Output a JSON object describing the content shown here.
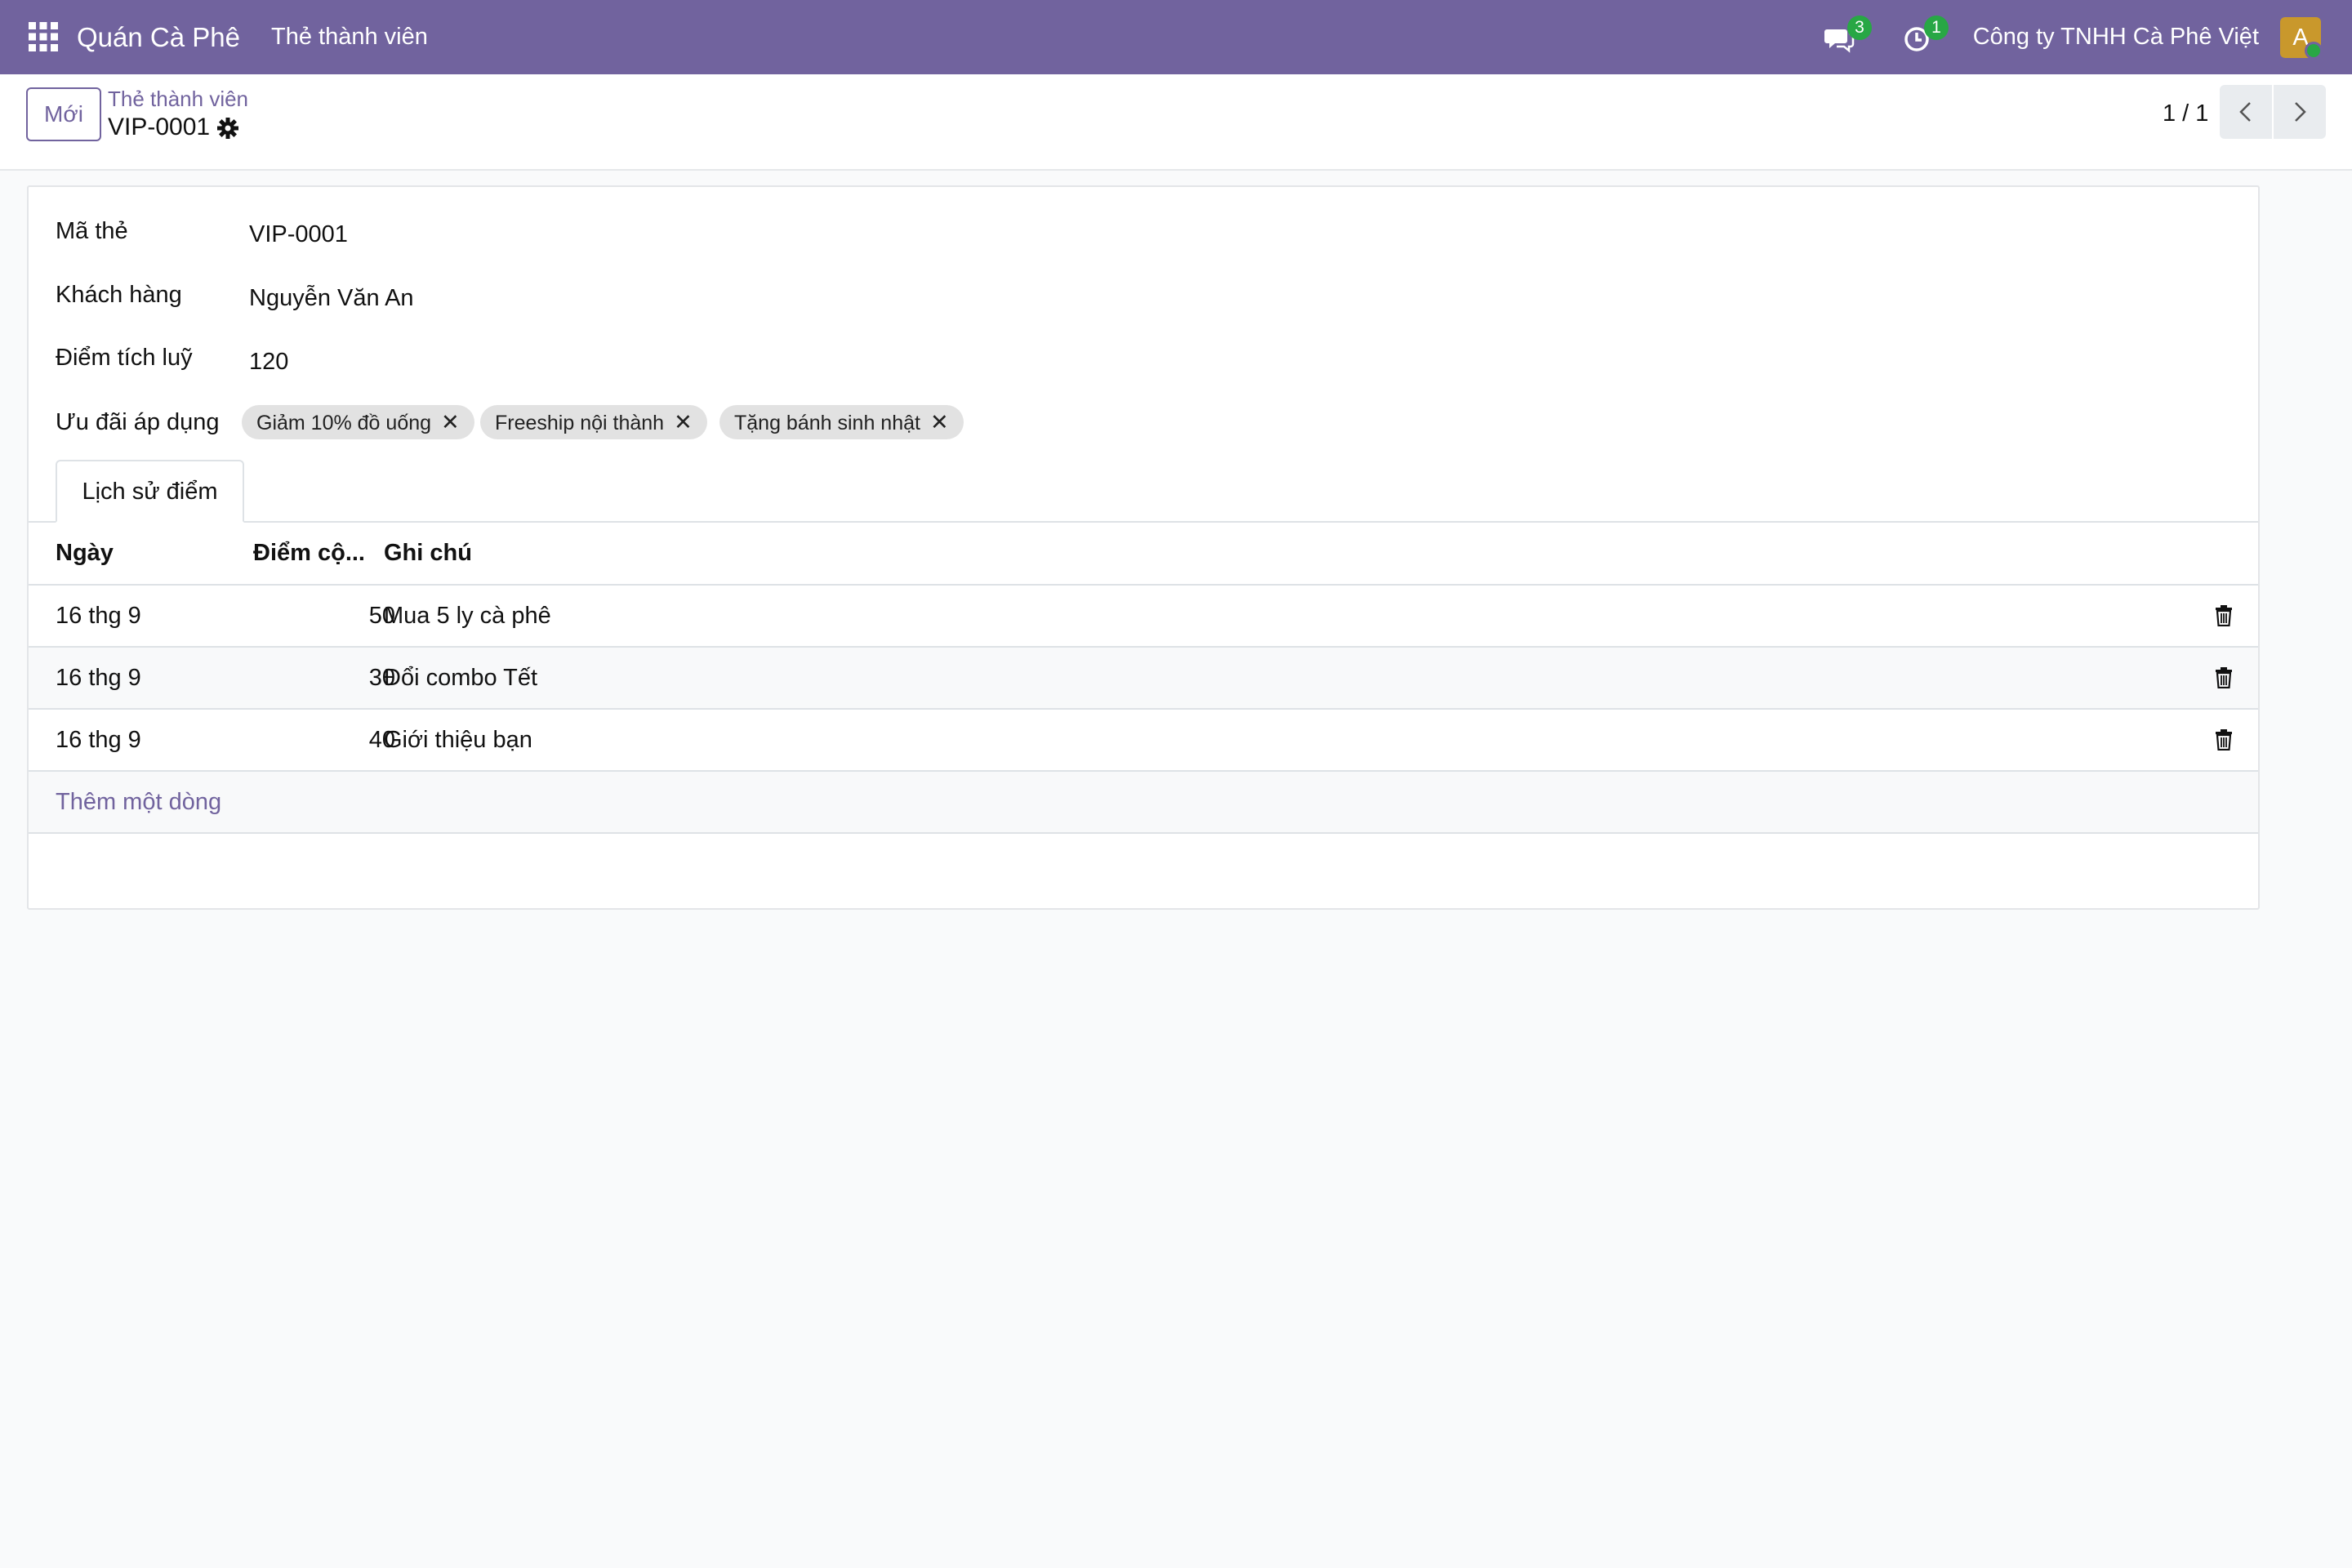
{
  "navbar": {
    "brand": "Quán Cà Phê",
    "menu_item": "Thẻ thành viên",
    "messages_count": "3",
    "activities_count": "1",
    "company": "Công ty TNHH Cà Phê Việt",
    "avatar_initial": "A",
    "color": "#71639e"
  },
  "control": {
    "new_label": "Mới",
    "breadcrumb_parent": "Thẻ thành viên",
    "breadcrumb_current": "VIP-0001",
    "pager": "1 / 1"
  },
  "form": {
    "fields": [
      {
        "label": "Mã thẻ",
        "value": "VIP-0001"
      },
      {
        "label": "Khách hàng",
        "value": "Nguyễn Văn An"
      },
      {
        "label": "Điểm tích luỹ",
        "value": "120"
      }
    ],
    "offers_label": "Ưu đãi áp dụng",
    "tags": [
      "Giảm 10% đồ uống",
      "Freeship nội thành",
      "Tặng bánh sinh nhật"
    ]
  },
  "tab": {
    "label": "Lịch sử điểm"
  },
  "table": {
    "headers": [
      "Ngày",
      "Điểm cộ...",
      "Ghi chú"
    ],
    "rows": [
      {
        "date": "16 thg 9",
        "points": "50",
        "note": "Mua 5 ly cà phê"
      },
      {
        "date": "16 thg 9",
        "points": "30",
        "note": "Đổi combo Tết"
      },
      {
        "date": "16 thg 9",
        "points": "40",
        "note": "Giới thiệu bạn"
      }
    ],
    "add_line": "Thêm một dòng"
  }
}
